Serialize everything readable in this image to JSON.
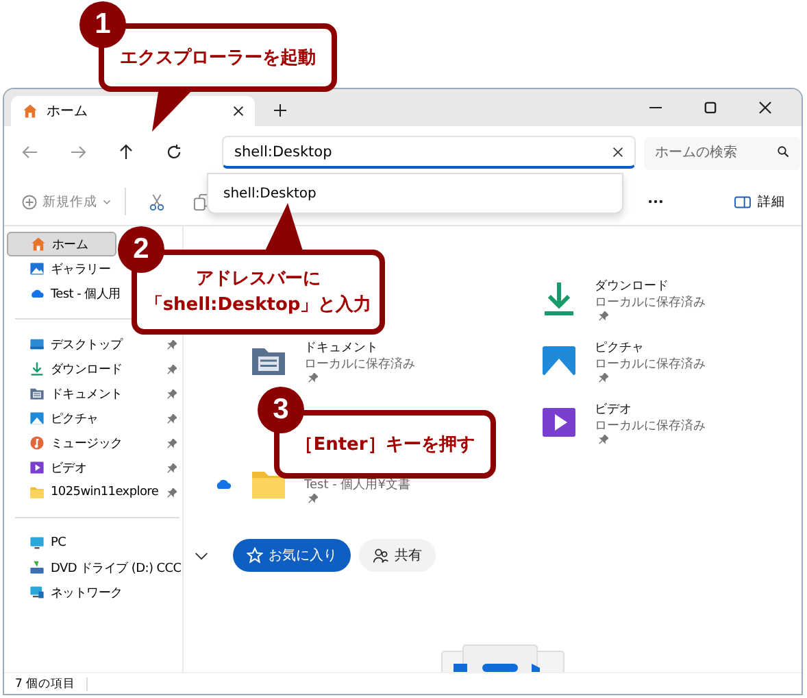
{
  "callouts": [
    {
      "number": "1",
      "text": "エクスプローラーを起動"
    },
    {
      "number": "2",
      "lines": [
        "アドレスバーに",
        "「shell:Desktop」と入力"
      ]
    },
    {
      "number": "3",
      "text": "［Enter］キーを押す"
    }
  ],
  "window": {
    "tabs": [
      {
        "label": "ホーム",
        "selected": true
      }
    ]
  },
  "address_bar": {
    "value": "shell:Desktop"
  },
  "search": {
    "placeholder": "ホームの検索"
  },
  "address_suggestions": [
    {
      "label": "shell:Desktop"
    }
  ],
  "toolbar": {
    "new_label": "新規作成",
    "details_label": "詳細"
  },
  "sidebar": {
    "groups": [
      [
        {
          "label": "ホーム",
          "kind": "home",
          "selected": true,
          "pinned": false
        },
        {
          "label": "ギャラリー",
          "kind": "gallery",
          "selected": false,
          "pinned": false
        },
        {
          "label": "Test - 個人用",
          "kind": "cloud",
          "selected": false,
          "pinned": false
        }
      ],
      [
        {
          "label": "デスクトップ",
          "kind": "desktop",
          "selected": false,
          "pinned": true
        },
        {
          "label": "ダウンロード",
          "kind": "download",
          "selected": false,
          "pinned": true
        },
        {
          "label": "ドキュメント",
          "kind": "documents",
          "selected": false,
          "pinned": true
        },
        {
          "label": "ピクチャ",
          "kind": "pictures",
          "selected": false,
          "pinned": true
        },
        {
          "label": "ミュージック",
          "kind": "music",
          "selected": false,
          "pinned": true
        },
        {
          "label": "ビデオ",
          "kind": "videos",
          "selected": false,
          "pinned": true
        },
        {
          "label": "1025win11explore",
          "kind": "folder",
          "selected": false,
          "pinned": true
        }
      ],
      [
        {
          "label": "PC",
          "kind": "pc",
          "selected": false,
          "pinned": false
        },
        {
          "label": "DVD ドライブ (D:) CCC",
          "kind": "dvd",
          "selected": false,
          "pinned": false
        },
        {
          "label": "ネットワーク",
          "kind": "network",
          "selected": false,
          "pinned": false
        }
      ]
    ]
  },
  "quick_access": {
    "left_column": [
      {
        "name": "ドキュメント",
        "detail": "ローカルに保存済み",
        "kind": "documents",
        "pinned": true,
        "cloud": false
      },
      {
        "detail": "Test - 個人用¥文書",
        "kind": "folder",
        "pinned": true,
        "cloud": true
      }
    ],
    "right_column": [
      {
        "name": "ダウンロード",
        "detail": "ローカルに保存済み",
        "kind": "download",
        "pinned": true,
        "cloud": false
      },
      {
        "name": "ピクチャ",
        "detail": "ローカルに保存済み",
        "kind": "pictures",
        "pinned": true,
        "cloud": false
      },
      {
        "name": "ビデオ",
        "detail": "ローカルに保存済み",
        "kind": "videos",
        "pinned": true,
        "cloud": false
      }
    ]
  },
  "filters": [
    {
      "label": "お気に入り",
      "kind": "star",
      "selected": true
    },
    {
      "label": "共有",
      "kind": "people",
      "selected": false
    }
  ],
  "status_bar": {
    "text": "7 個の項目"
  }
}
